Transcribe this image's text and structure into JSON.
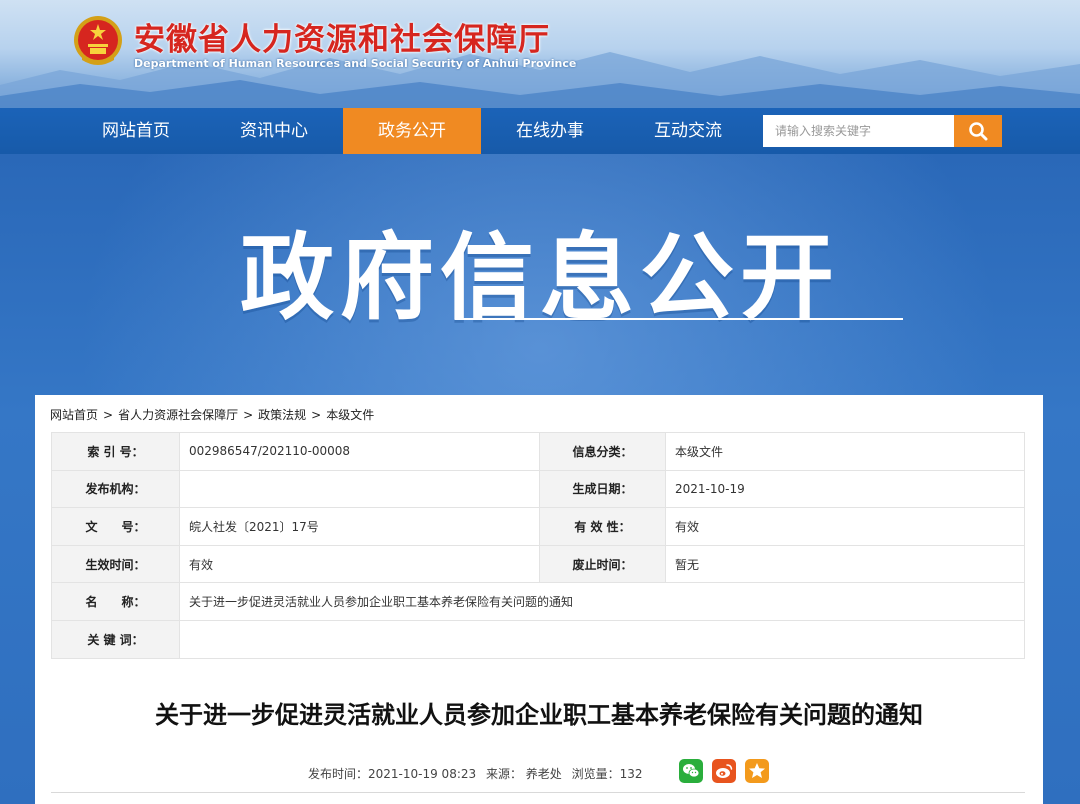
{
  "header": {
    "title": "安徽省人力资源和社会保障厅",
    "subtitle": "Department of Human Resources and Social Security of Anhui Province",
    "emblem_icon": "national-emblem-icon"
  },
  "nav": {
    "items": [
      {
        "label": "网站首页"
      },
      {
        "label": "资讯中心"
      },
      {
        "label": "政务公开",
        "active": true
      },
      {
        "label": "在线办事"
      },
      {
        "label": "互动交流"
      }
    ],
    "search_placeholder": "请输入搜索关键字",
    "search_icon": "search-icon"
  },
  "banner": {
    "title": "政府信息公开"
  },
  "breadcrumb": {
    "items": [
      "网站首页",
      "省人力资源社会保障厅",
      "政策法规",
      "本级文件"
    ],
    "separator": ">"
  },
  "info_table": {
    "rows": [
      {
        "l1": "索 引 号：",
        "v1": "002986547/202110-00008",
        "l2": "信息分类：",
        "v2": "本级文件"
      },
      {
        "l1": "发布机构：",
        "v1": "",
        "l2": "生成日期：",
        "v2": "2021-10-19"
      },
      {
        "l1": "文　　号：",
        "v1": "皖人社发〔2021〕17号",
        "l2": "有 效 性：",
        "v2": "有效"
      },
      {
        "l1": "生效时间：",
        "v1": "有效",
        "l2": "废止时间：",
        "v2": "暂无"
      },
      {
        "l1": "名　　称：",
        "v1": "关于进一步促进灵活就业人员参加企业职工基本养老保险有关问题的通知"
      },
      {
        "l1": "关 键 词：",
        "v1": ""
      }
    ]
  },
  "article": {
    "title": "关于进一步促进灵活就业人员参加企业职工基本养老保险有关问题的通知",
    "publish_time_label": "发布时间：2021-10-19 08:23",
    "source_label": "来源：  养老处",
    "views_label": "浏览量：132",
    "share_icons": [
      "wechat-icon",
      "weibo-icon",
      "favorite-star-icon"
    ],
    "colors": {
      "wechat": "#2aae3c",
      "weibo": "#e8541e",
      "favorite": "#f39a1c"
    }
  }
}
